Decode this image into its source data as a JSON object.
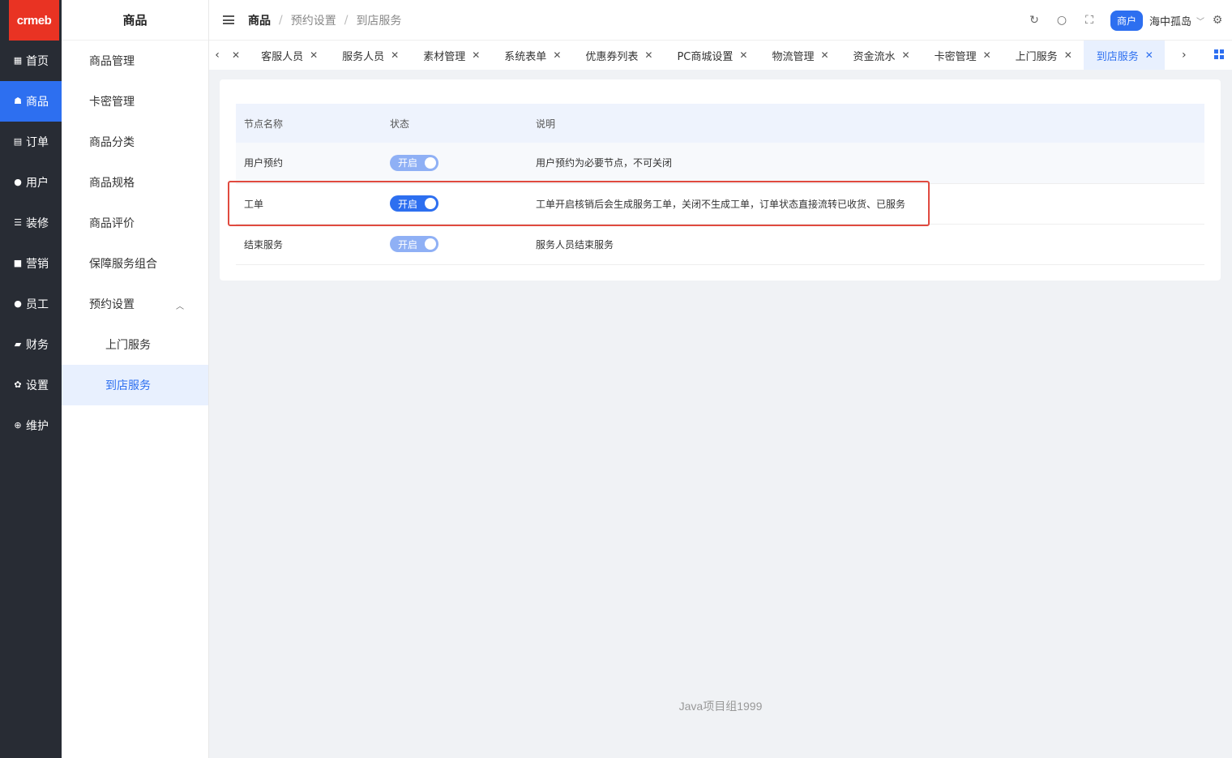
{
  "logo": "crmeb",
  "nav": [
    {
      "icon": "grid-icon",
      "label": "首页"
    },
    {
      "icon": "bag-icon",
      "label": "商品"
    },
    {
      "icon": "clipboard-icon",
      "label": "订单"
    },
    {
      "icon": "user-icon",
      "label": "用户"
    },
    {
      "icon": "sliders-icon",
      "label": "装修"
    },
    {
      "icon": "chat-icon",
      "label": "营销"
    },
    {
      "icon": "user-icon",
      "label": "员工"
    },
    {
      "icon": "wallet-icon",
      "label": "财务"
    },
    {
      "icon": "gear-icon",
      "label": "设置"
    },
    {
      "icon": "plus-circle-icon",
      "label": "维护"
    }
  ],
  "submenu": {
    "title": "商品",
    "items": [
      "商品管理",
      "卡密管理",
      "商品分类",
      "商品规格",
      "商品评价",
      "保障服务组合",
      "预约设置",
      "上门服务",
      "到店服务"
    ]
  },
  "header": {
    "breadcrumb": [
      "商品",
      "预约设置",
      "到店服务"
    ],
    "merchant_badge": "商户",
    "username": "海中孤岛"
  },
  "tabs": [
    "",
    "客服人员",
    "服务人员",
    "素材管理",
    "系统表单",
    "优惠券列表",
    "PC商城设置",
    "物流管理",
    "资金流水",
    "卡密管理",
    "上门服务",
    "到店服务"
  ],
  "table": {
    "headers": [
      "节点名称",
      "状态",
      "说明"
    ],
    "rows": [
      {
        "name": "用户预约",
        "status": "开启",
        "desc": "用户预约为必要节点，不可关闭"
      },
      {
        "name": "工单",
        "status": "开启",
        "desc": "工单开启核销后会生成服务工单，关闭不生成工单，订单状态直接流转已收货、已服务"
      },
      {
        "name": "结束服务",
        "status": "开启",
        "desc": "服务人员结束服务"
      }
    ]
  },
  "footer": "Java项目组1999",
  "colors": {
    "primary": "#2d6ff0",
    "nav_bg": "#282c34",
    "logo_bg": "#e93323",
    "highlight": "#e04a3f"
  }
}
